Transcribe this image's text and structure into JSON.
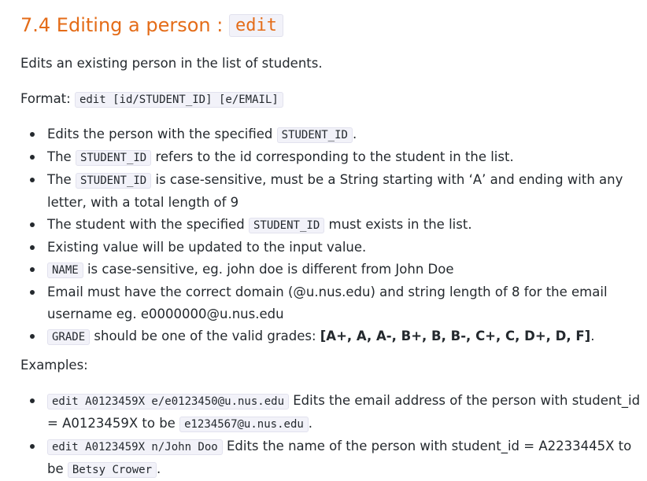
{
  "section": {
    "title_prefix": "7.4 Editing a person : ",
    "title_code": "edit"
  },
  "intro": "Edits an existing person in the list of students.",
  "format": {
    "label": "Format: ",
    "code": "edit [id/STUDENT_ID] [e/EMAIL]"
  },
  "bullets": {
    "b1": {
      "pre": "Edits the person with the specified ",
      "code": "STUDENT_ID",
      "post": "."
    },
    "b2": {
      "pre": "The ",
      "code": "STUDENT_ID",
      "post": " refers to the id corresponding to the student in the list."
    },
    "b3": {
      "pre": "The ",
      "code": "STUDENT_ID",
      "post": " is case-sensitive, must be a String starting with ‘A’ and ending with any letter, with a total length of 9"
    },
    "b4": {
      "pre": "The student with the specified ",
      "code": "STUDENT_ID",
      "post": " must exists in the list."
    },
    "b5": {
      "text": "Existing value will be updated to the input value."
    },
    "b6": {
      "code": "NAME",
      "post": " is case-sensitive, eg. john doe is different from John Doe"
    },
    "b7": {
      "text": "Email must have the correct domain (@u.nus.edu) and string length of 8 for the email username eg. e0000000@u.nus.edu"
    },
    "b8": {
      "code": "GRADE",
      "mid": " should be one of the valid grades: ",
      "bold": "[A+, A, A-, B+, B, B-, C+, C, D+, D, F]",
      "post": "."
    }
  },
  "examples_label": "Examples:",
  "examples": {
    "e1": {
      "code": "edit A0123459X e/e0123450@u.nus.edu",
      "mid": " Edits the email address of the person with student_id = A0123459X to be ",
      "code2": "e1234567@u.nus.edu",
      "post": "."
    },
    "e2": {
      "code": "edit A0123459X n/John Doo",
      "mid": " Edits the name of the person with student_id = A2233445X to be ",
      "code2": "Betsy Crower",
      "post": "."
    }
  }
}
